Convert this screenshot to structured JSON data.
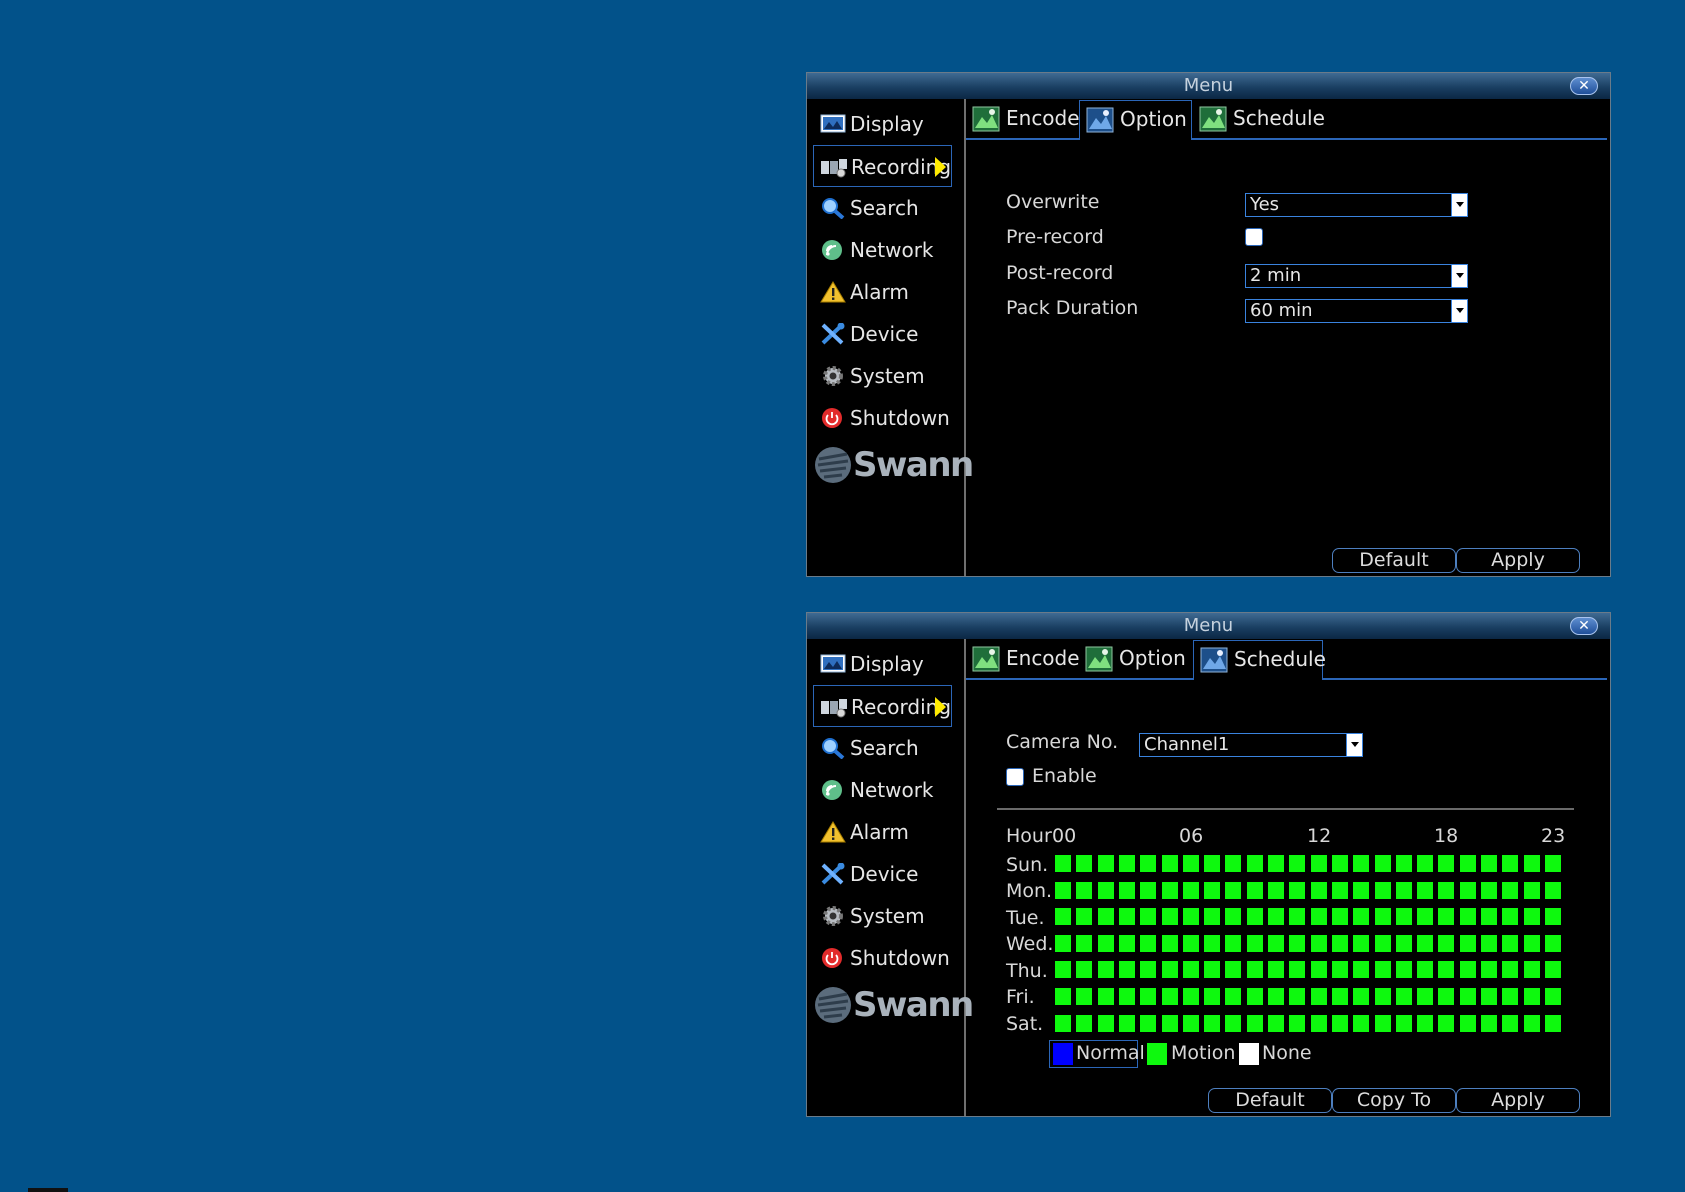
{
  "colors": {
    "background": "#02528a",
    "accent": "#2b66b8",
    "schedule_motion": "#0ef90e",
    "schedule_normal": "#0000ff",
    "schedule_none": "#ffffff"
  },
  "windows": [
    {
      "title": "Menu",
      "sidebar": [
        {
          "label": "Display",
          "icon": "display-icon"
        },
        {
          "label": "Recording",
          "icon": "recording-icon",
          "active": true
        },
        {
          "label": "Search",
          "icon": "search-icon"
        },
        {
          "label": "Network",
          "icon": "network-icon"
        },
        {
          "label": "Alarm",
          "icon": "alarm-icon"
        },
        {
          "label": "Device",
          "icon": "device-icon"
        },
        {
          "label": "System",
          "icon": "system-icon"
        },
        {
          "label": "Shutdown",
          "icon": "shutdown-icon"
        }
      ],
      "logo": "Swann",
      "tabs": [
        {
          "label": "Encode"
        },
        {
          "label": "Option",
          "active": true
        },
        {
          "label": "Schedule"
        }
      ],
      "option": {
        "overwrite_label": "Overwrite",
        "overwrite_value": "Yes",
        "prerecord_label": "Pre-record",
        "prerecord_checked": false,
        "postrecord_label": "Post-record",
        "postrecord_value": "2 min",
        "pack_label": "Pack Duration",
        "pack_value": "60 min"
      },
      "buttons": {
        "default": "Default",
        "apply": "Apply"
      }
    },
    {
      "title": "Menu",
      "sidebar": [
        {
          "label": "Display",
          "icon": "display-icon"
        },
        {
          "label": "Recording",
          "icon": "recording-icon",
          "active": true
        },
        {
          "label": "Search",
          "icon": "search-icon"
        },
        {
          "label": "Network",
          "icon": "network-icon"
        },
        {
          "label": "Alarm",
          "icon": "alarm-icon"
        },
        {
          "label": "Device",
          "icon": "device-icon"
        },
        {
          "label": "System",
          "icon": "system-icon"
        },
        {
          "label": "Shutdown",
          "icon": "shutdown-icon"
        }
      ],
      "logo": "Swann",
      "tabs": [
        {
          "label": "Encode"
        },
        {
          "label": "Option"
        },
        {
          "label": "Schedule",
          "active": true
        }
      ],
      "schedule": {
        "camera_label": "Camera No.",
        "camera_value": "Channel1",
        "enable_label": "Enable",
        "enable_checked": false,
        "hour_label": "Hour",
        "hour_ticks": [
          "00",
          "06",
          "12",
          "18",
          "23"
        ],
        "days": [
          "Sun.",
          "Mon.",
          "Tue.",
          "Wed.",
          "Thu.",
          "Fri.",
          "Sat."
        ],
        "hours_per_day": 24,
        "fill_mode": "Motion",
        "legend": [
          {
            "label": "Normal",
            "color": "#0000ff",
            "selected": true
          },
          {
            "label": "Motion",
            "color": "#0ef90e"
          },
          {
            "label": "None",
            "color": "#ffffff"
          }
        ]
      },
      "buttons": {
        "default": "Default",
        "copy_to": "Copy To",
        "apply": "Apply"
      }
    }
  ]
}
